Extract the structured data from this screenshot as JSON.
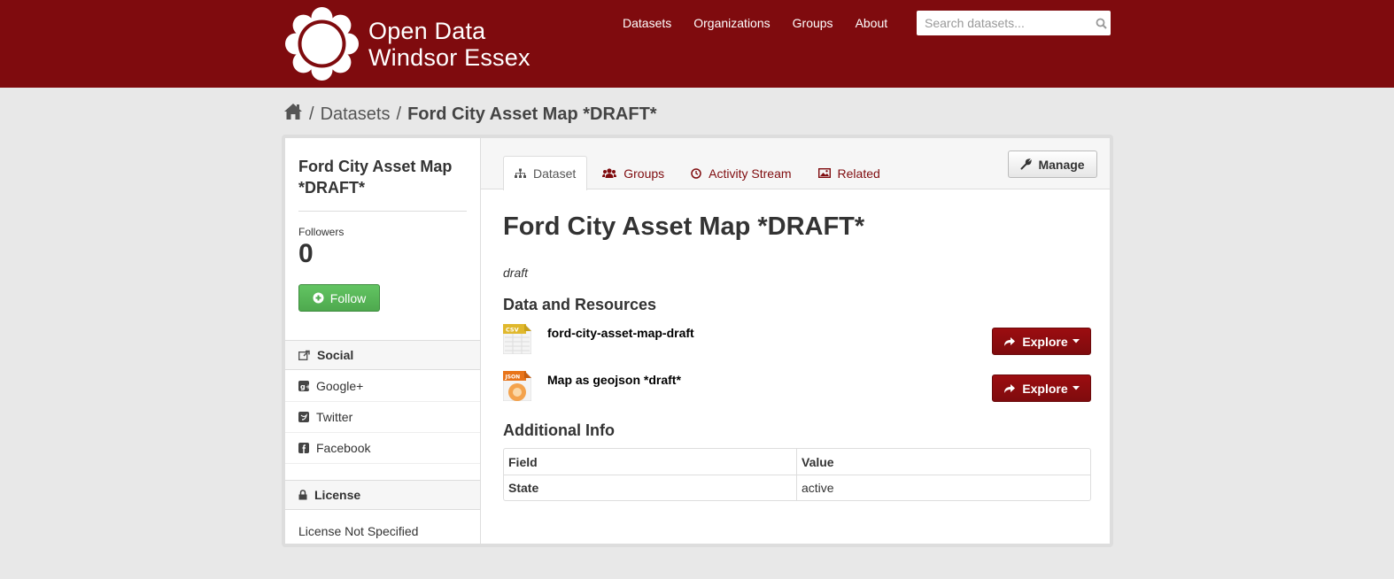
{
  "site": {
    "title_line1": "Open Data",
    "title_line2": "Windsor Essex",
    "nav": [
      "Datasets",
      "Organizations",
      "Groups",
      "About"
    ],
    "search_placeholder": "Search datasets..."
  },
  "breadcrumb": {
    "home_icon": "home-icon",
    "sep": "/",
    "datasets": "Datasets",
    "current": "Ford City Asset Map *DRAFT*"
  },
  "sidebar": {
    "title": "Ford City Asset Map *DRAFT*",
    "followers_label": "Followers",
    "followers_count": "0",
    "follow_label": "Follow",
    "social_heading": "Social",
    "social_items": [
      "Google+",
      "Twitter",
      "Facebook"
    ],
    "license_heading": "License",
    "license_text": "License Not Specified"
  },
  "tabs": [
    "Dataset",
    "Groups",
    "Activity Stream",
    "Related"
  ],
  "manage_label": "Manage",
  "dataset": {
    "title": "Ford City Asset Map *DRAFT*",
    "notes": "draft",
    "resources_heading": "Data and Resources",
    "resources": [
      {
        "name": "ford-city-asset-map-draft",
        "format": "CSV",
        "format_color": "#e0b82d"
      },
      {
        "name": "Map as geojson *draft*",
        "format": "JSON",
        "format_color": "#e8741a"
      }
    ],
    "explore_label": "Explore",
    "additional_heading": "Additional Info",
    "table": {
      "headers": [
        "Field",
        "Value"
      ],
      "rows": [
        [
          "State",
          "active"
        ]
      ]
    }
  },
  "colors": {
    "brand": "#7f0b0e",
    "follow_green": "#5bb75b",
    "background": "#e8e8e8"
  }
}
